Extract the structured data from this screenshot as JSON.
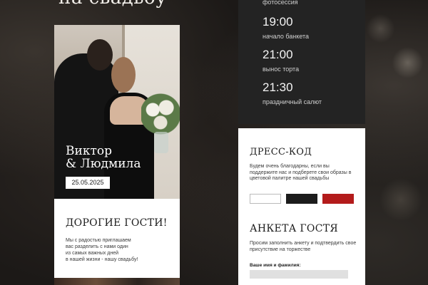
{
  "hero": {
    "title_partial": "на свадьбу"
  },
  "photo_card": {
    "names": "Виктор\n& Людмила",
    "date": "25.05.2025"
  },
  "guests_card": {
    "heading": "ДОРОГИЕ ГОСТИ!",
    "body": "Мы с радостью приглашаем\nвас разделить с нами один\nиз самых важных дней\nв нашей жизни - нашу свадьбу!"
  },
  "timeline": {
    "top_label": "фотосессия",
    "items": [
      {
        "time": "19:00",
        "label": "начало банкета"
      },
      {
        "time": "21:00",
        "label": "вынос торта"
      },
      {
        "time": "21:30",
        "label": "праздничный салют"
      }
    ]
  },
  "dress_code": {
    "title": "ДРЕСС-КОД",
    "text": "Будем очень благодарны, если вы поддержите нас и подберете свои образы в цветовой палитре нашей свадьбы",
    "swatches": [
      "#ffffff",
      "#1c1c1c",
      "#b31b1b"
    ]
  },
  "guest_form": {
    "title": "АНКЕТА ГОСТЯ",
    "text": "Просим заполнить анкету и подтвердить свое присутствие на торжестве",
    "name_label": "Ваше имя и фамилия:",
    "name_value": ""
  }
}
